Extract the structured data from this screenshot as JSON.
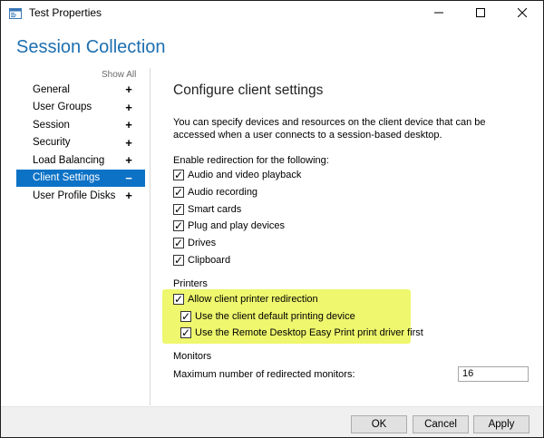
{
  "window": {
    "title": "Test Properties",
    "app_icon": "properties-app-icon",
    "controls": {
      "minimize": "—",
      "maximize": "☐",
      "close": "✕"
    }
  },
  "header": {
    "title": "Session Collection"
  },
  "sidebar": {
    "show_all": "Show All",
    "items": [
      {
        "label": "General",
        "sign": "+"
      },
      {
        "label": "User Groups",
        "sign": "+"
      },
      {
        "label": "Session",
        "sign": "+"
      },
      {
        "label": "Security",
        "sign": "+"
      },
      {
        "label": "Load Balancing",
        "sign": "+"
      },
      {
        "label": "Client Settings",
        "sign": "−",
        "selected": true
      },
      {
        "label": "User Profile Disks",
        "sign": "+"
      }
    ]
  },
  "main": {
    "title": "Configure client settings",
    "description": "You can specify devices and resources on the client device that can be accessed when a user connects to a session-based desktop.",
    "enable_label": "Enable redirection for the following:",
    "redirection": [
      {
        "label": "Audio and video playback",
        "checked": true
      },
      {
        "label": "Audio recording",
        "checked": true
      },
      {
        "label": "Smart cards",
        "checked": true
      },
      {
        "label": "Plug and play devices",
        "checked": true
      },
      {
        "label": "Drives",
        "checked": true
      },
      {
        "label": "Clipboard",
        "checked": true
      }
    ],
    "printers": {
      "label": "Printers",
      "allow": {
        "label": "Allow client printer redirection",
        "checked": true
      },
      "default_device": {
        "label": "Use the client default printing device",
        "checked": true
      },
      "easy_print": {
        "label": "Use the Remote Desktop Easy Print print driver first",
        "checked": true
      },
      "highlight_color": "#eef76d"
    },
    "monitors": {
      "label": "Monitors",
      "max_label": "Maximum number of redirected monitors:",
      "max_value": "16"
    }
  },
  "footer": {
    "ok": "OK",
    "cancel": "Cancel",
    "apply": "Apply"
  },
  "colors": {
    "accent": "#1d6fb0",
    "selected_bg": "#0c72c6"
  }
}
